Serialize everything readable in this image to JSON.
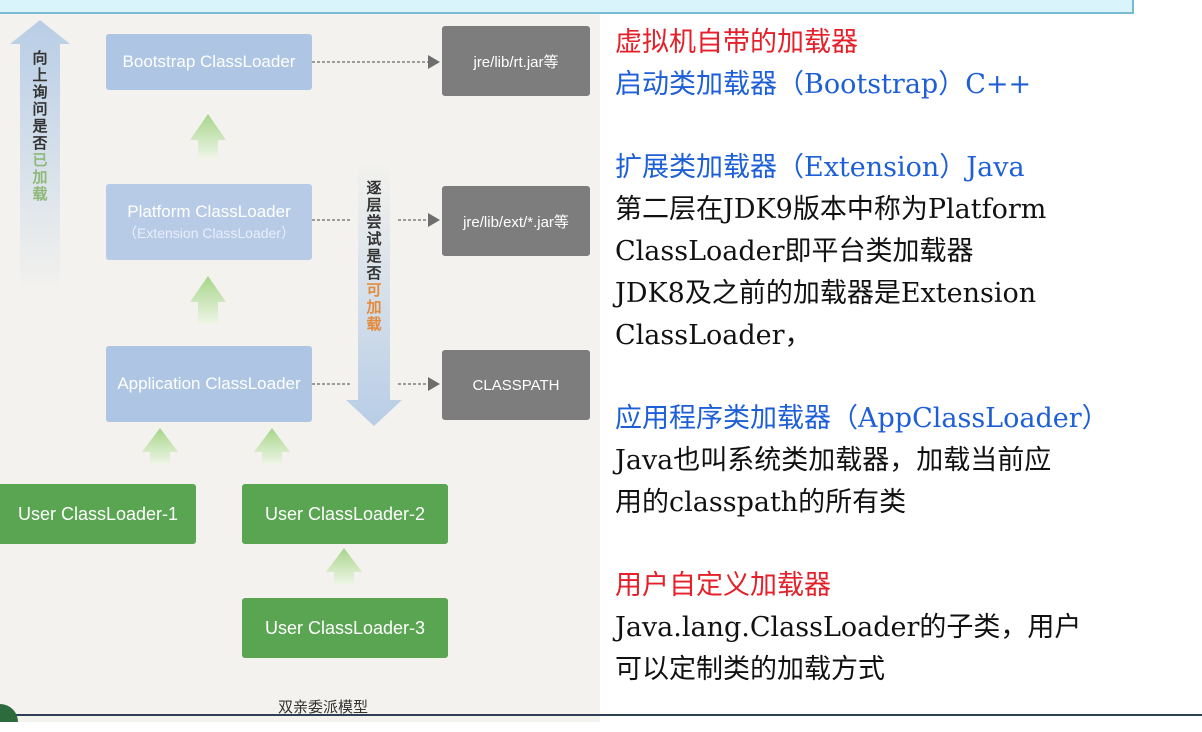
{
  "diagram": {
    "caption": "双亲委派模型",
    "up_label": [
      "向",
      "上",
      "询",
      "问",
      "是",
      "否",
      "已",
      "加",
      "载"
    ],
    "down_label": [
      "逐",
      "层",
      "尝",
      "试",
      "是",
      "否",
      "可",
      "加",
      "载"
    ],
    "loaders": {
      "bootstrap": "Bootstrap ClassLoader",
      "platform": "Platform ClassLoader",
      "platform_sub": "（Extension ClassLoader）",
      "application": "Application ClassLoader",
      "user1": "User ClassLoader-1",
      "user2": "User ClassLoader-2",
      "user3": "User ClassLoader-3"
    },
    "paths": {
      "rt": "jre/lib/rt.jar等",
      "ext": "jre/lib/ext/*.jar等",
      "classpath": "CLASSPATH"
    },
    "colors": {
      "blue_box": "#aec5e3",
      "gray_box": "#7d7d7d",
      "green_box": "#5aa552",
      "arrow_green": "#bfe0a8",
      "accent_red": "#e4202a",
      "accent_blue": "#1d5fd7"
    }
  },
  "text": {
    "s1": {
      "title": "虚拟机自带的加载器",
      "subtitle": "启动类加载器（Bootstrap）C++"
    },
    "s2": {
      "title": "扩展类加载器（Extension）Java",
      "lines": [
        "第二层在JDK9版本中称为Platform",
        "ClassLoader即平台类加载器",
        "JDK8及之前的加载器是Extension",
        "ClassLoader，"
      ]
    },
    "s3": {
      "title": "应用程序类加载器（AppClassLoader）",
      "lines": [
        "Java也叫系统类加载器，加载当前应",
        "用的classpath的所有类"
      ]
    },
    "s4": {
      "title": "用户自定义加载器",
      "lines": [
        "Java.lang.ClassLoader的子类，用户",
        "可以定制类的加载方式"
      ]
    }
  }
}
